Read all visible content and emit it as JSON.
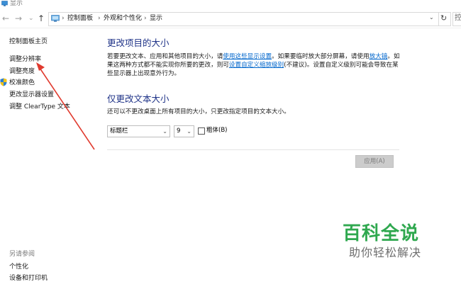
{
  "window": {
    "title": "显示"
  },
  "nav": {
    "back": "←",
    "forward": "→",
    "recent": "⌄",
    "up": "↑",
    "breadcrumbs": [
      "控制面板",
      "外观和个性化",
      "显示"
    ],
    "separator": "›",
    "dropdown": "⌄",
    "refresh": "↻",
    "search_partial": "控"
  },
  "sidebar": {
    "items": [
      {
        "label": "控制面板主页"
      },
      {
        "label": "调整分辨率"
      },
      {
        "label": "调整亮度"
      },
      {
        "label": "校准颜色"
      },
      {
        "label": "更改显示器设置"
      },
      {
        "label": "调整 ClearType 文本"
      }
    ],
    "see_also": {
      "heading": "另请参阅",
      "items": [
        {
          "label": "个性化"
        },
        {
          "label": "设备和打印机"
        }
      ]
    }
  },
  "main": {
    "section1": {
      "heading": "更改项目的大小",
      "line1_a": "若要更改文本、应用和其他项目的大小，请",
      "line1_link": "使用这些显示设置",
      "line1_b": "。如果要临时放大部分屏幕，请使用",
      "line1_link2": "放大镜",
      "line1_c": "。如",
      "line2_a": "果这两种方式都不能实现你所要的更改，则可",
      "line2_link": "设置自定义缩放级别",
      "line2_b": "(不建议)。设置自定义级别可能会导致在某",
      "line3": "些显示器上出现意外行为。"
    },
    "section2": {
      "heading": "仅更改文本大小",
      "description": "还可以不更改桌面上所有项目的大小，只更改指定项目的文本大小。",
      "item_select": {
        "value": "标题栏"
      },
      "size_select": {
        "value": "9"
      },
      "bold_label": "粗体(B)",
      "select_arrow": "⌄"
    },
    "apply_button": "应用(A)"
  },
  "watermark": {
    "title": "百科全说",
    "subtitle": "助你轻松解决"
  },
  "colors": {
    "heading": "#1e3287",
    "link": "#0066cc",
    "annotation_arrow": "#e03a2e",
    "watermark_green": "#2fa84f"
  },
  "icons": {
    "title": "display-icon",
    "address": "control-panel-icon",
    "calibrate": "shield-icon"
  }
}
